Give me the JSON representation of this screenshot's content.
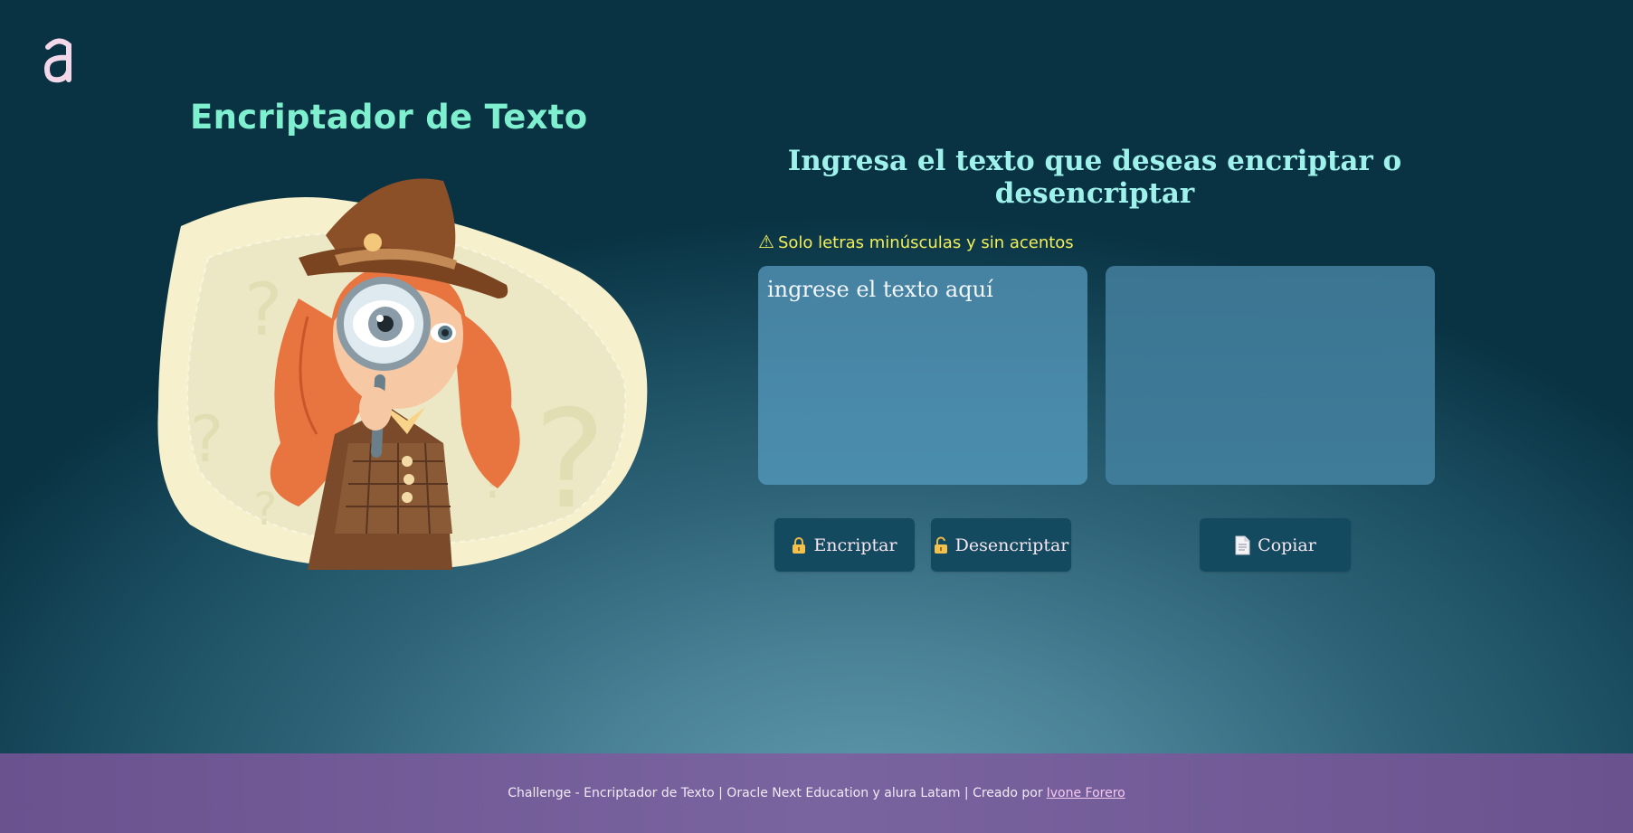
{
  "header": {
    "logo_icon": "alura-logo-icon",
    "title": "Encriptador de Texto"
  },
  "illustration": {
    "name": "detective-girl-magnifier-illustration"
  },
  "main": {
    "prompt": "Ingresa el texto que deseas encriptar o desencriptar",
    "warning_icon": "warning-icon",
    "warning_text": "Solo letras minúsculas y sin acentos",
    "input": {
      "placeholder": "ingrese el texto aquí",
      "value": ""
    },
    "output": {
      "value": ""
    },
    "buttons": {
      "encrypt_label": "Encriptar",
      "decrypt_label": "Desencriptar",
      "copy_label": "Copiar"
    }
  },
  "footer": {
    "text": "Challenge - Encriptador de Texto | Oracle Next Education y alura Latam | Creado por",
    "author_link": "Ivone Forero"
  },
  "colors": {
    "title": "#7ff0cf",
    "prompt": "#9ff2ec",
    "warning": "#f2ef5a",
    "button_bg": "#144a60",
    "footer_bg": "#7a64a0"
  }
}
